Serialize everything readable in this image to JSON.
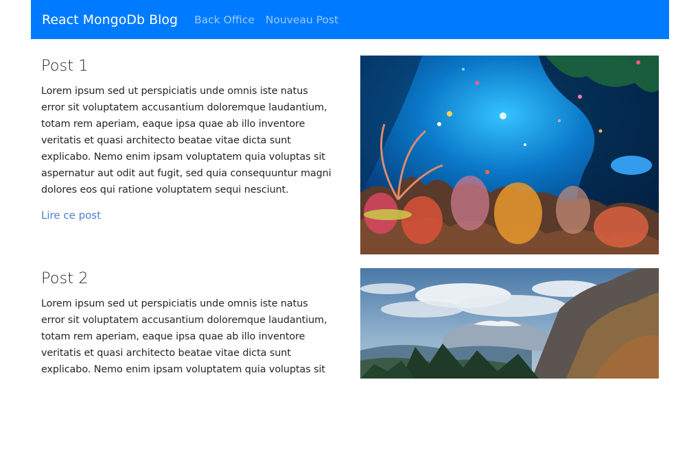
{
  "navbar": {
    "brand": "React MongoDb Blog",
    "links": [
      "Back Office",
      "Nouveau Post"
    ],
    "color": "#007bff"
  },
  "posts": [
    {
      "title": "Post 1",
      "body_lines": [
        "Lorem ipsum sed ut perspiciatis unde omnis iste natus",
        "error sit voluptatem accusantium doloremque laudantium,",
        "totam rem aperiam, eaque ipsa quae ab illo inventore",
        "veritatis et quasi architecto beatae vitae dicta sunt",
        "explicabo. Nemo enim ipsam voluptatem quia voluptas sit",
        "aspernatur aut odit aut fugit, sed quia consequuntur magni",
        "dolores eos qui ratione voluptatem sequi nesciunt."
      ],
      "link": "Lire ce post",
      "image": "coral-reef-image"
    },
    {
      "title": "Post 2",
      "body_lines": [
        "Lorem ipsum sed ut perspiciatis unde omnis iste natus",
        "error sit voluptatem accusantium doloremque laudantium,",
        "totam rem aperiam, eaque ipsa quae ab illo inventore",
        "veritatis et quasi architecto beatae vitae dicta sunt",
        "explicabo. Nemo enim ipsam voluptatem quia voluptas sit"
      ],
      "image": "mountain-landscape-image"
    }
  ]
}
